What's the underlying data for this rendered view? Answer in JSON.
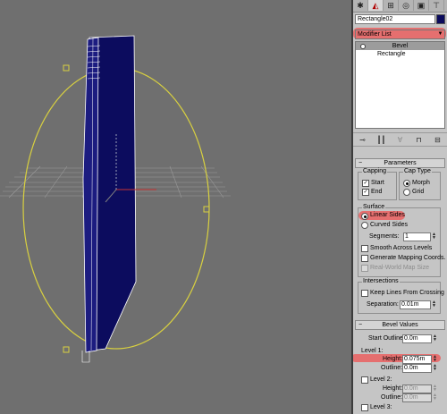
{
  "command_panel": {
    "tabs": [
      {
        "icon": "create-icon",
        "glyph": "✱"
      },
      {
        "icon": "modify-icon",
        "glyph": "◭"
      },
      {
        "icon": "hierarchy-icon",
        "glyph": "⊞"
      },
      {
        "icon": "motion-icon",
        "glyph": "◎"
      },
      {
        "icon": "display-icon",
        "glyph": "▣"
      },
      {
        "icon": "utilities-icon",
        "glyph": "⊤"
      }
    ],
    "object_name": "Rectangle02",
    "object_color": "#0a0a5c",
    "modifier_list": "Modifier List",
    "highlight_color": "#ff2828",
    "stack": {
      "items": [
        "Bevel",
        "Rectangle"
      ],
      "selected": "Bevel"
    },
    "stack_tools": [
      "pin-stack-icon",
      "show-end-result-icon",
      "make-unique-icon",
      "remove-modifier-icon",
      "configure-sets-icon"
    ]
  },
  "parameters": {
    "title": "Parameters",
    "capping": {
      "label": "Capping",
      "start": "Start",
      "end": "End",
      "start_checked": true,
      "end_checked": true
    },
    "cap_type": {
      "label": "Cap Type",
      "morph": "Morph",
      "grid": "Grid",
      "selected": "Morph"
    },
    "surface": {
      "label": "Surface",
      "linear_sides": "Linear Sides",
      "curved_sides": "Curved Sides",
      "selected": "Linear Sides",
      "segments_label": "Segments:",
      "segments_value": "1",
      "smooth_across_levels": "Smooth Across Levels",
      "generate_mapping": "Generate Mapping Coords.",
      "real_world_map_size": "Real-World Map Size"
    },
    "intersections": {
      "label": "Intersections",
      "keep_lines": "Keep Lines From Crossing",
      "separation_label": "Separation:",
      "separation_value": "0.01m"
    }
  },
  "bevel_values": {
    "title": "Bevel Values",
    "start_outline_label": "Start Outline:",
    "start_outline_value": "0.0m",
    "level1": {
      "label": "Level 1:",
      "height_label": "Height:",
      "height_value": "0.075m",
      "outline_label": "Outline:",
      "outline_value": "0.0m"
    },
    "level2": {
      "label": "Level 2:",
      "height_label": "Height:",
      "height_value": "0.0m",
      "outline_label": "Outline:",
      "outline_value": "0.0m"
    },
    "level3": {
      "label": "Level 3:"
    }
  },
  "viewport": {
    "background": "#6f6f6f",
    "object_fill": "#0c0c5e",
    "gizmo_color": "#d8d040",
    "grid_color": "#9a9a9a"
  }
}
